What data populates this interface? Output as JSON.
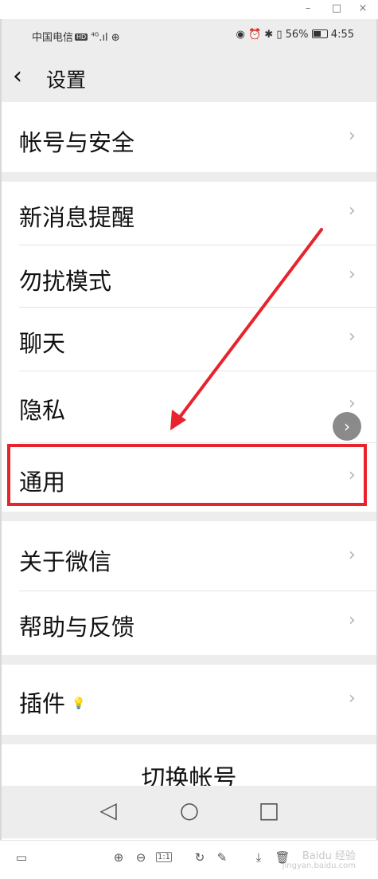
{
  "window": {
    "minimize": "–",
    "maximize": "□",
    "close": "×"
  },
  "status_bar": {
    "carrier": "中国电信",
    "hd_badge": "HD",
    "network": "4G",
    "battery_percent": "56%",
    "time": "4:55",
    "icons": [
      "eye-icon",
      "alarm-icon",
      "bluetooth-icon",
      "vibrate-icon",
      "battery-icon"
    ]
  },
  "header": {
    "back_glyph": "‹",
    "title": "设置"
  },
  "sections": {
    "account": {
      "label": "帐号与安全"
    },
    "new_msg": {
      "label": "新消息提醒"
    },
    "dnd": {
      "label": "勿扰模式"
    },
    "chat": {
      "label": "聊天"
    },
    "privacy": {
      "label": "隐私"
    },
    "general": {
      "label": "通用"
    },
    "about": {
      "label": "关于微信"
    },
    "help": {
      "label": "帮助与反馈"
    },
    "plugins": {
      "label": "插件"
    },
    "switch_account": {
      "label": "切换帐号"
    }
  },
  "chevron": "›",
  "floating_button": "›",
  "annotation": {
    "highlight_color": "#e8232d",
    "arrow_color": "#e8232d"
  },
  "nav": {
    "back": "◁",
    "home": "○",
    "recent": "□"
  },
  "viewer_toolbar": {
    "ratio_label": "1:1",
    "watermark": "Baidu 经验",
    "watermark_url": "jingyan.baidu.com"
  }
}
